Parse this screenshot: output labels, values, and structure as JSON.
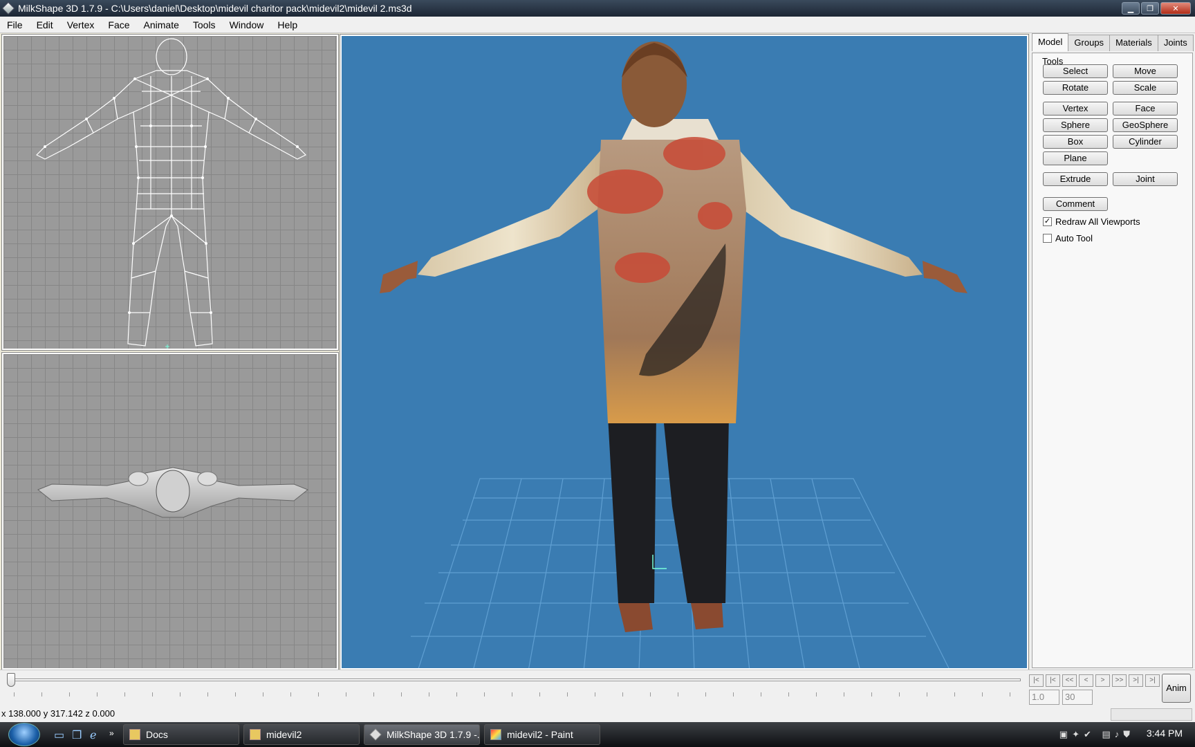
{
  "window": {
    "title": "MilkShape 3D 1.7.9 - C:\\Users\\daniel\\Desktop\\midevil charitor pack\\midevil2\\midevil 2.ms3d",
    "minimize": "▁",
    "maximize": "❐",
    "close": "✕"
  },
  "menu": [
    "File",
    "Edit",
    "Vertex",
    "Face",
    "Animate",
    "Tools",
    "Window",
    "Help"
  ],
  "panel": {
    "tabs": [
      "Model",
      "Groups",
      "Materials",
      "Joints"
    ],
    "group_label": "Tools",
    "buttons": {
      "select": "Select",
      "move": "Move",
      "rotate": "Rotate",
      "scale": "Scale",
      "vertex": "Vertex",
      "face": "Face",
      "sphere": "Sphere",
      "geosphere": "GeoSphere",
      "box": "Box",
      "cylinder": "Cylinder",
      "plane": "Plane",
      "extrude": "Extrude",
      "joint": "Joint",
      "comment": "Comment"
    },
    "redraw_label": "Redraw All Viewports",
    "redraw_checked": true,
    "autotool_label": "Auto Tool",
    "autotool_checked": false
  },
  "timeline": {
    "nav": [
      "|<",
      "|<",
      "<<",
      "<",
      ">",
      ">>",
      ">|",
      ">|"
    ],
    "frame_value": "1.0",
    "frame_total": "30",
    "anim_label": "Anim"
  },
  "status": {
    "coords": "x 138.000 y 317.142 z 0.000"
  },
  "taskbar": {
    "items": [
      {
        "label": "Docs",
        "icon": "folder-icon"
      },
      {
        "label": "midevil2",
        "icon": "folder-icon"
      },
      {
        "label": "MilkShape 3D 1.7.9 -...",
        "icon": "milkshape-icon"
      },
      {
        "label": "midevil2 - Paint",
        "icon": "paint-icon"
      }
    ],
    "clock": "3:44 PM"
  },
  "colors": {
    "viewport_3d_bg": "#3a7cb2",
    "ortho_bg": "#9a9a9a"
  }
}
